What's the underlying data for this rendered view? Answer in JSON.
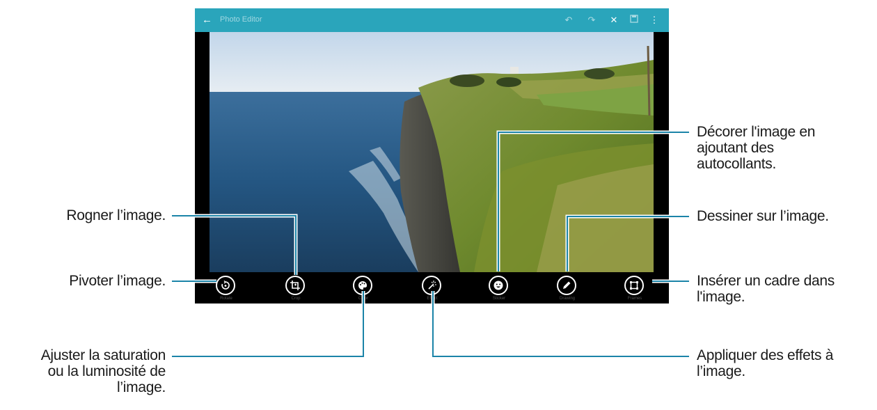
{
  "app": {
    "title": "Photo Editor",
    "accent": "#2aa5bb"
  },
  "toolbar": {
    "tools": [
      {
        "label": "Rotate",
        "icon": "rotate-icon"
      },
      {
        "label": "Crop",
        "icon": "crop-icon"
      },
      {
        "label": "Color",
        "icon": "palette-icon"
      },
      {
        "label": "Effect",
        "icon": "magic-wand-icon"
      },
      {
        "label": "Sticker",
        "icon": "smiley-icon"
      },
      {
        "label": "Drawing",
        "icon": "pencil-icon"
      },
      {
        "label": "Frames",
        "icon": "frame-icon"
      }
    ]
  },
  "callouts": {
    "crop": "Rogner l’image.",
    "rotate": "Pivoter l’image.",
    "color": [
      "Ajuster la saturation",
      "ou la luminosité de",
      "l’image."
    ],
    "sticker": [
      "Décorer l'image en",
      "ajoutant des",
      "autocollants."
    ],
    "drawing": "Dessiner sur l’image.",
    "frames": [
      "Insérer un cadre dans",
      "l'image."
    ],
    "effect": [
      "Appliquer des effets à",
      "l’image."
    ]
  },
  "line_color": "#1b84a8"
}
